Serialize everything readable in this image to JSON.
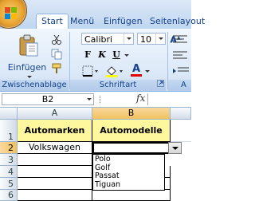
{
  "tabs": [
    "Start",
    "Menü",
    "Einfügen",
    "Seitenlayout"
  ],
  "active_tab": "Start",
  "ribbon": {
    "paste_label": "Einfügen",
    "clipboard_group": "Zwischenablage",
    "font_group": "Schriftart",
    "alignment_group_partial": "A",
    "font_name": "Calibri",
    "font_size": "10",
    "bold": "F",
    "italic": "K",
    "underline": "U",
    "grow_font": "A",
    "shrink_font": "A",
    "font_color_letter": "A"
  },
  "formula_bar": {
    "name_box": "B2",
    "fx": "fx",
    "value": ""
  },
  "columns": [
    "A",
    "B"
  ],
  "rows": [
    "1",
    "2",
    "3",
    "4",
    "5",
    "6"
  ],
  "cells": {
    "A1": "Automarken",
    "B1": "Automodelle",
    "A2": "Volkswagen",
    "B2": ""
  },
  "dropdown_options": [
    "Polo",
    "Golf",
    "Passat",
    "Tiguan"
  ],
  "colors": {
    "header_fill": "#fff79e",
    "ribbon_text": "#15428b",
    "selected_header": "#f1c15f"
  }
}
